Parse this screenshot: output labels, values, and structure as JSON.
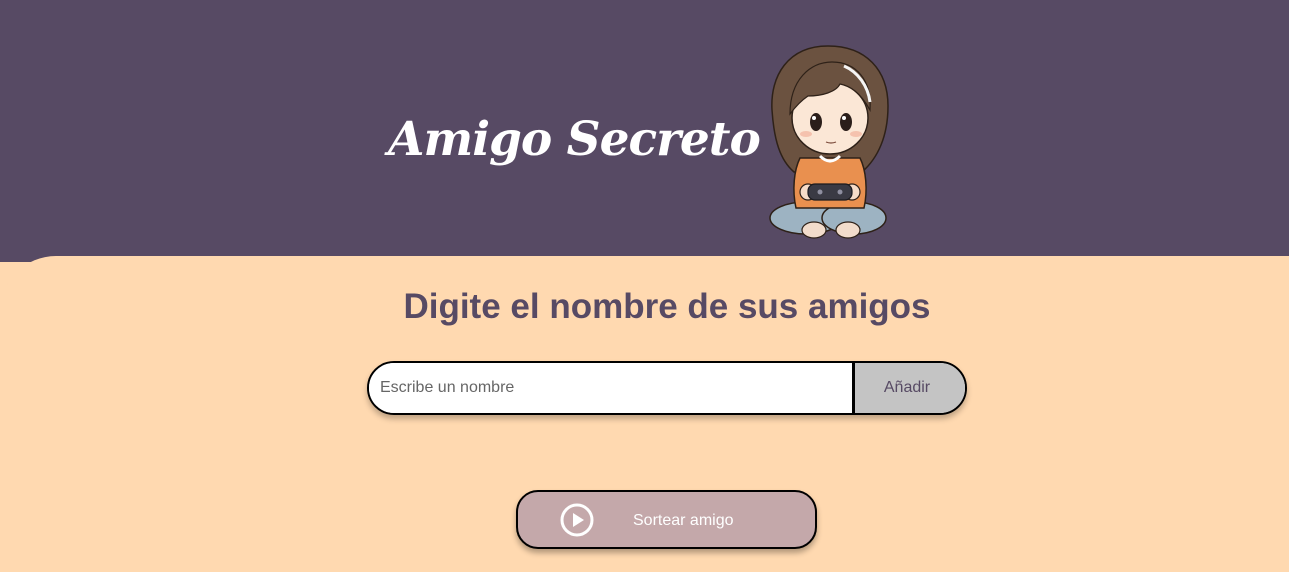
{
  "header": {
    "title": "Amigo Secreto",
    "illustration_icon": "girl-playing-videogame-illustration"
  },
  "main": {
    "subtitle": "Digite el nombre de sus amigos",
    "input": {
      "placeholder": "Escribe un nombre",
      "value": ""
    },
    "add_button_label": "Añadir",
    "draw_button": {
      "label": "Sortear amigo",
      "icon": "play-circle-icon"
    }
  },
  "colors": {
    "header_bg": "#574A64",
    "main_bg": "#FFD9B0",
    "subtitle": "#574A64",
    "add_button_bg": "#C4C4C4",
    "draw_button_bg": "#C4A8AA"
  }
}
